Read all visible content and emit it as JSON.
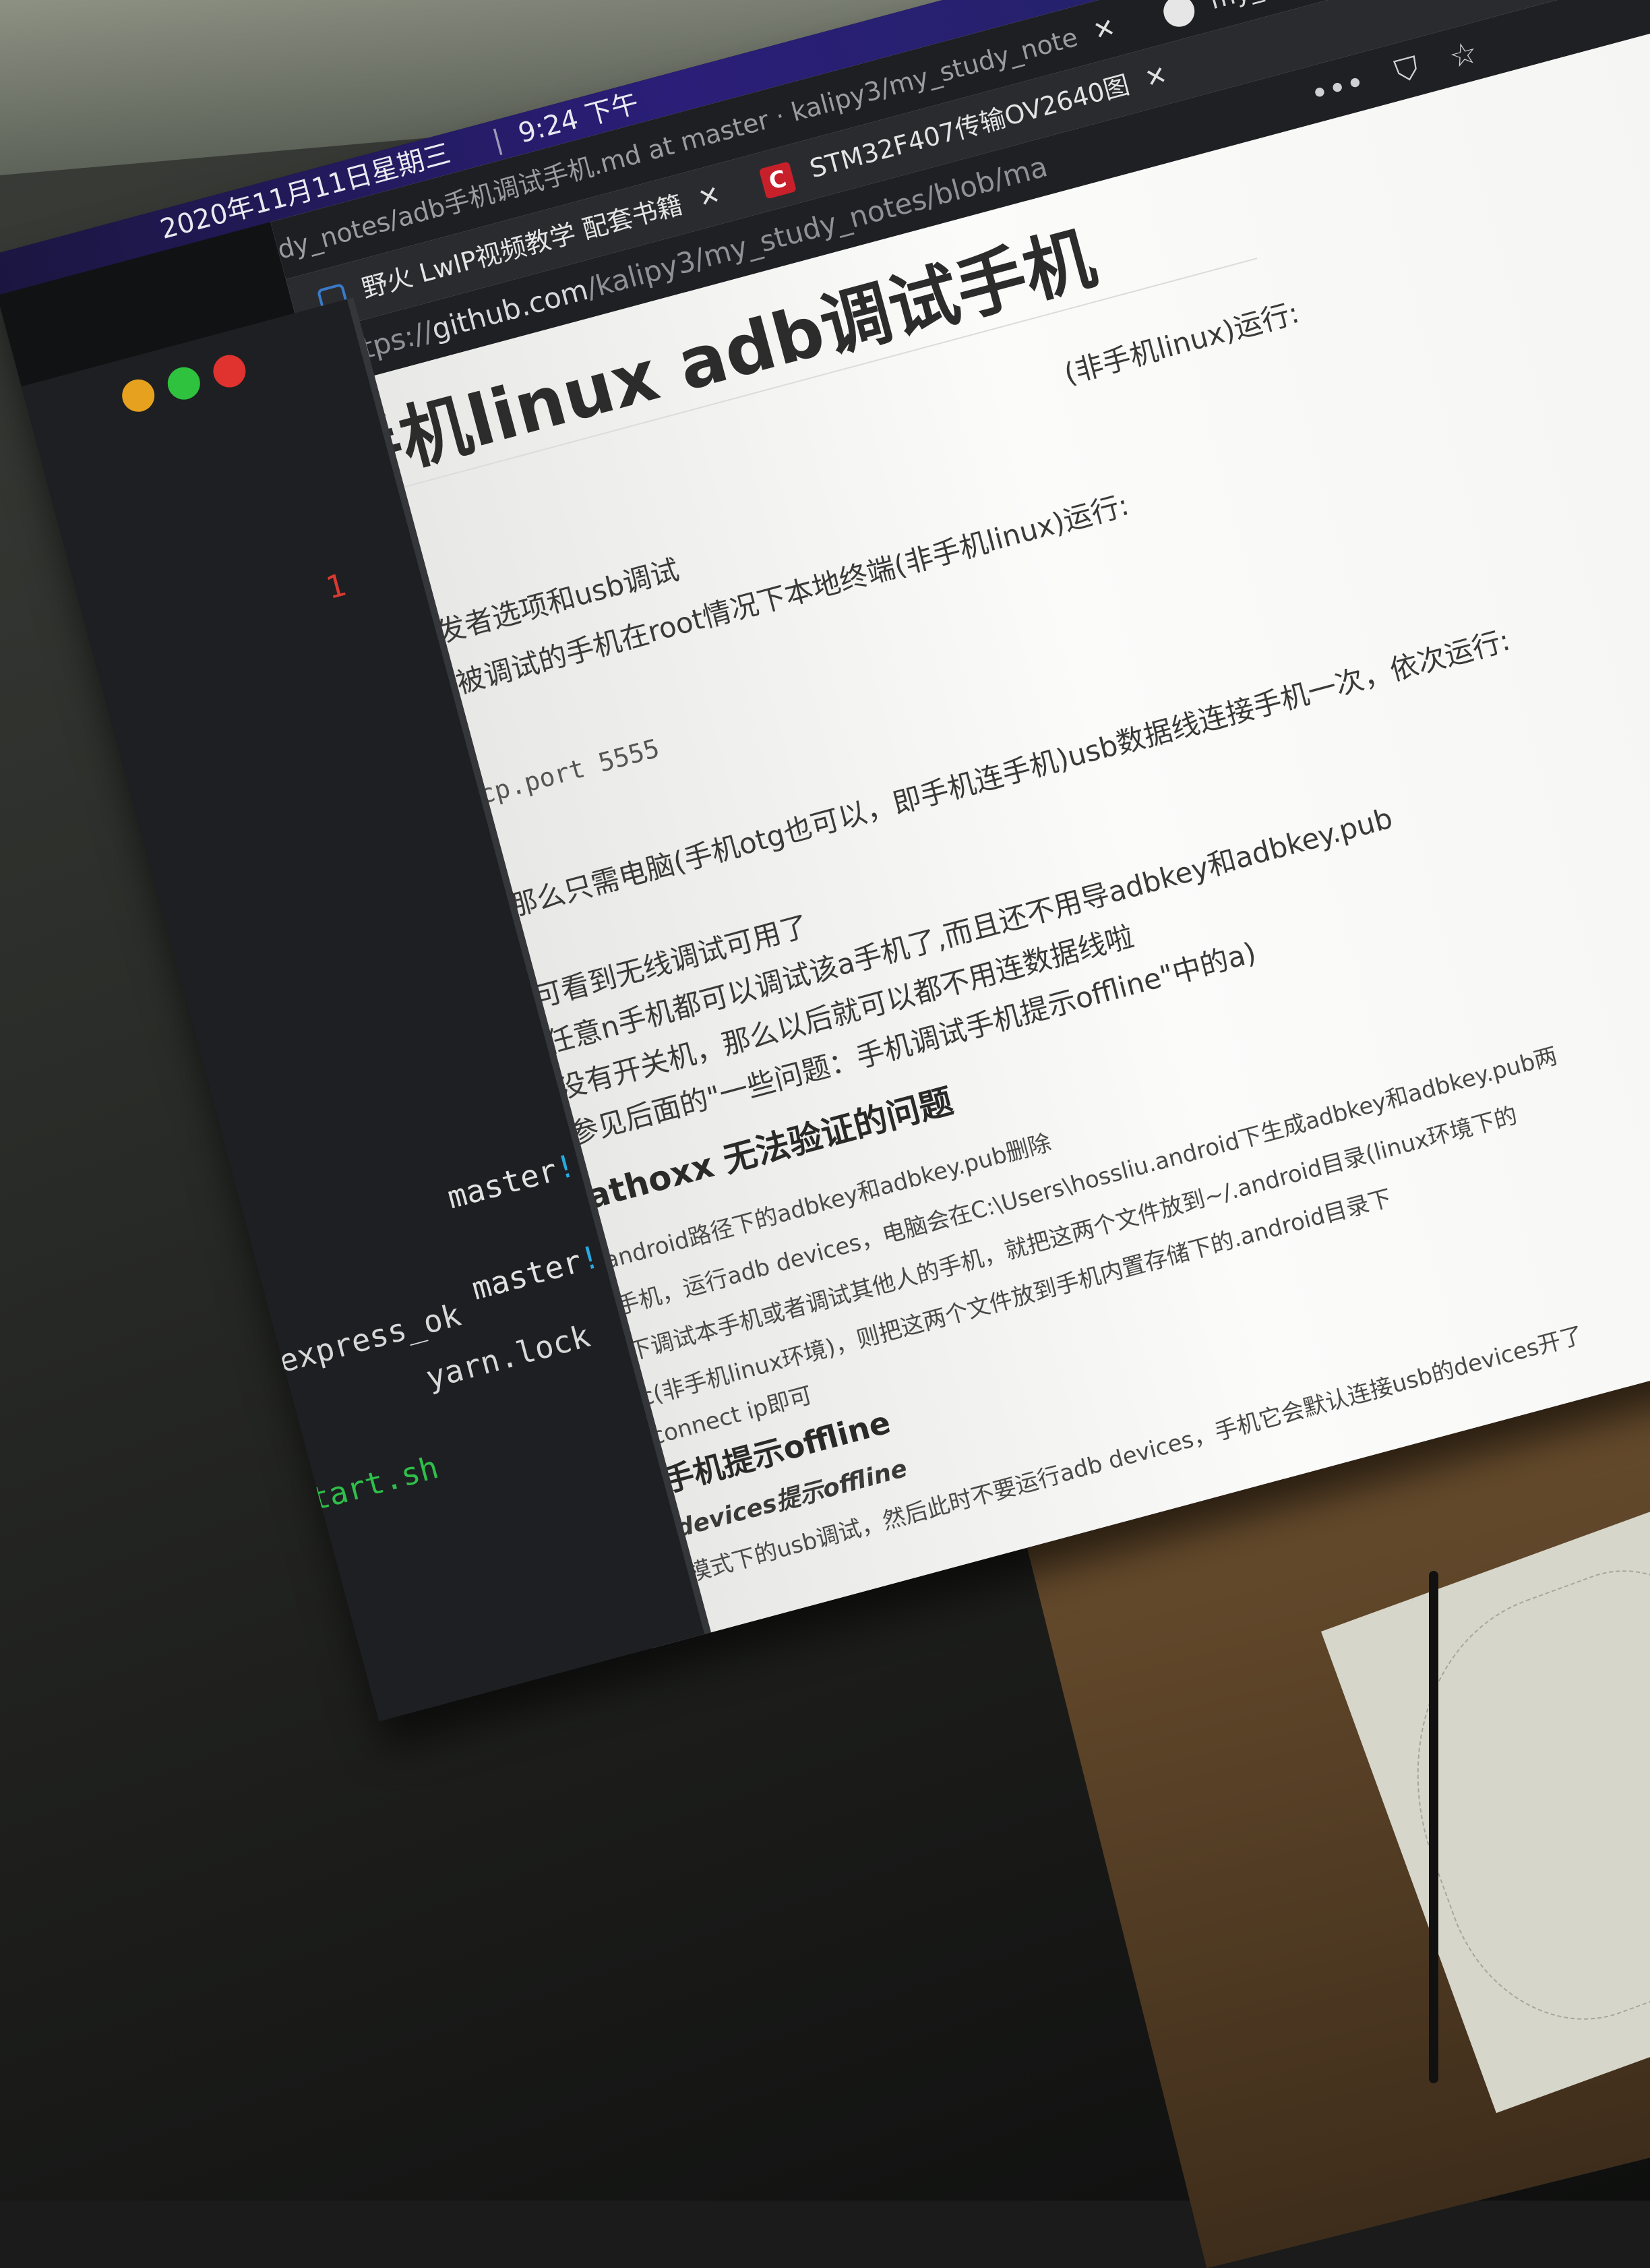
{
  "topbar": {
    "datetime": "2020年11月11日星期三",
    "separator": "|",
    "time": "9:24 下午"
  },
  "browser": {
    "tabs_row1": [
      {
        "label": "dy_notes/adb手机调试手机.md at master · kalipy3/my_study_note",
        "close": "✕"
      },
      {
        "label": "my_study",
        "close": ""
      }
    ],
    "tabs_row2": [
      {
        "label": "野火 LwIP视频教学 配套书籍",
        "close": "✕"
      },
      {
        "label": "STM32F407传输OV2640图",
        "close": "✕"
      }
    ],
    "url": {
      "scheme": "https://",
      "host": "github.com",
      "path": "/kalipy3/my_study_notes/blob/ma"
    },
    "url_actions": [
      "•••",
      "⛉",
      "☆"
    ],
    "toolbar_icons": [
      "⤓",
      "|||\\",
      "▣",
      "●"
    ]
  },
  "page": {
    "title": "手机linux adb调试手机",
    "lines": [
      "(非手机linux)运行:",
      "开发者选项和usb调试",
      "被调试的手机在root情况下本地终端(非手机linux)运行:",
      "cp.port 5555",
      "那么只需电脑(手机otg也可以，即手机连手机)usb数据线连接手机一次，依次运行:",
      "可看到无线调试可用了",
      "任意n手机都可以调试该a手机了,而且还不用导adbkey和adbkey.pub",
      "没有开关机，那么以后就可以都不用连数据线啦",
      "参见后面的\"一些问题：手机调试手机提示offline\"中的a)",
      "athoxx 无法验证的问题",
      "android路径下的adbkey和adbkey.pub删除",
      "手机，运行adb devices，电脑会在C:\\Users\\hossliu.android下生成adbkey和adbkey.pub两",
      "下调试本手机或者调试其他人的手机，就把这两个文件放到~/.android目录(linux环境下的",
      "c(非手机linux环境)，则把这两个文件放到手机内置存储下的.android目录下",
      "connect ip即可",
      "手机提示offline",
      "devices提示offline",
      "模式下的usb调试，然后此时不要运行adb devices，手机它会默认连接usb的devices开了"
    ]
  },
  "terminal": {
    "lines": [
      {
        "text": "1"
      },
      {
        "text": "master",
        "suffix": "!"
      },
      {
        "text": "./express_ok"
      },
      {
        "text": "yarn.lock"
      },
      {
        "text": "master",
        "suffix": "!"
      },
      {
        "text": "start.sh"
      }
    ]
  }
}
